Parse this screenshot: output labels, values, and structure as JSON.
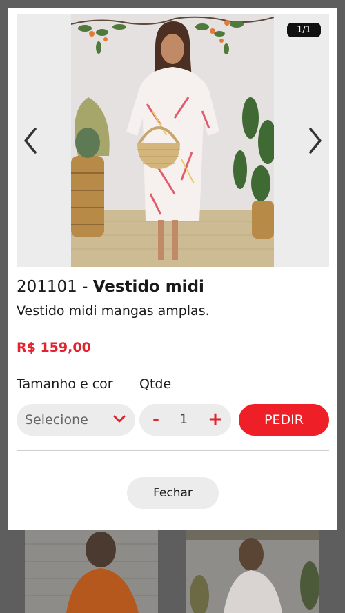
{
  "carousel": {
    "counter": "1/1",
    "prev_icon": "chevron-left-icon",
    "next_icon": "chevron-right-icon"
  },
  "product": {
    "code": "201101",
    "separator": " - ",
    "name": "Vestido midi",
    "description": "Vestido midi mangas amplas.",
    "price": "R$ 159,00"
  },
  "options": {
    "size_color_label": "Tamanho e cor",
    "qty_label": "Qtde",
    "select_value": "Selecione",
    "minus": "-",
    "quantity": "1",
    "plus": "+",
    "order_button": "PEDIR"
  },
  "footer": {
    "close_button": "Fechar"
  },
  "colors": {
    "accent": "#ee1f26",
    "price": "#e3232f",
    "overlay": "#5e5e5e"
  }
}
